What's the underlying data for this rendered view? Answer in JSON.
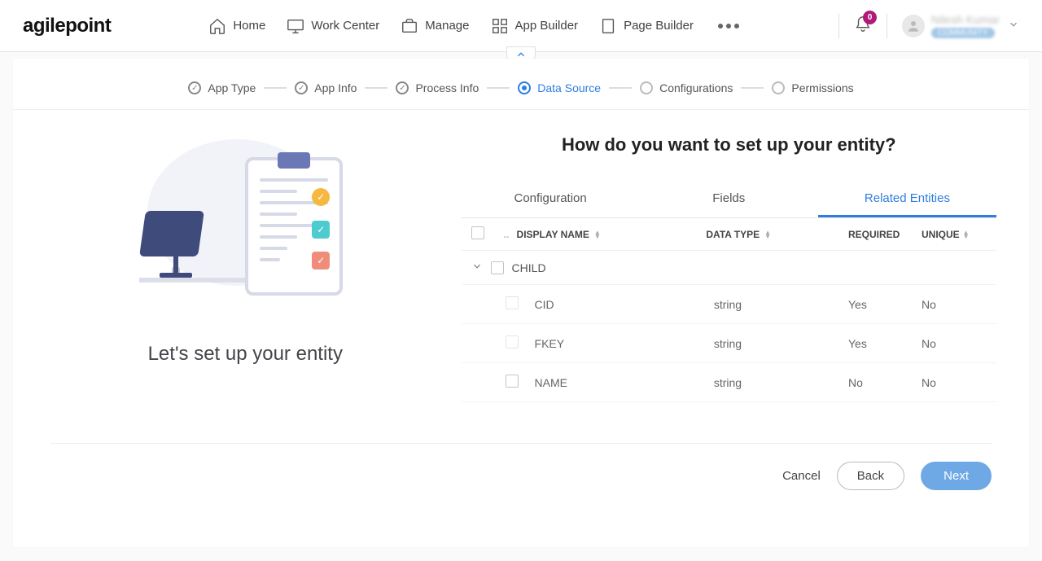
{
  "brand": "agilepoint",
  "nav": {
    "home": "Home",
    "workcenter": "Work Center",
    "manage": "Manage",
    "appbuilder": "App Builder",
    "pagebuilder": "Page Builder"
  },
  "notifications": {
    "count": "0"
  },
  "user": {
    "name": "Nilesh Kumar",
    "tag": "COMMUNITY"
  },
  "stepper": {
    "app_type": "App Type",
    "app_info": "App Info",
    "process_info": "Process Info",
    "data_source": "Data Source",
    "configurations": "Configurations",
    "permissions": "Permissions"
  },
  "left": {
    "caption": "Let's set up your entity"
  },
  "right": {
    "title": "How do you want to set up your entity?",
    "tabs": {
      "configuration": "Configuration",
      "fields": "Fields",
      "related": "Related Entities"
    },
    "headers": {
      "display_name": "DISPLAY NAME",
      "data_type": "DATA TYPE",
      "required": "REQUIRED",
      "unique": "UNIQUE"
    },
    "group": "CHILD",
    "rows": [
      {
        "name": "CID",
        "type": "string",
        "required": "Yes",
        "unique": "No"
      },
      {
        "name": "FKEY",
        "type": "string",
        "required": "Yes",
        "unique": "No"
      },
      {
        "name": "NAME",
        "type": "string",
        "required": "No",
        "unique": "No"
      }
    ]
  },
  "footer": {
    "cancel": "Cancel",
    "back": "Back",
    "next": "Next"
  }
}
